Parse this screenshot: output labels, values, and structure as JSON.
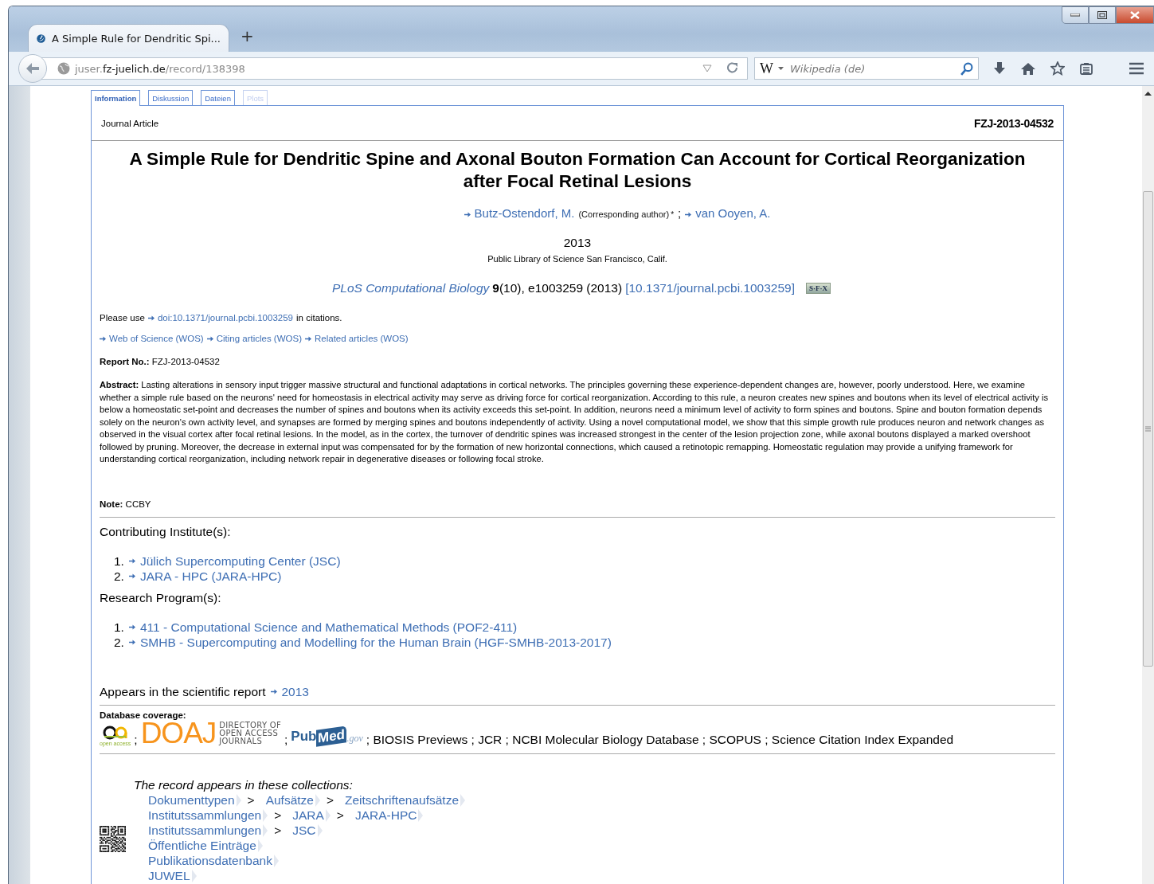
{
  "browser": {
    "tab": {
      "title": "A Simple Rule for Dendritic Spi...",
      "new_tab": "+"
    },
    "address": {
      "url": "juser.**fz-juelich.de**/record/138398"
    },
    "search": {
      "engine": "W",
      "placeholder": "Wikipedia (de)"
    }
  },
  "record_tabs": [
    {
      "label": "Information",
      "selected": true,
      "disabled": false
    },
    {
      "label": "Diskussion",
      "selected": false,
      "disabled": false
    },
    {
      "label": "Dateien",
      "selected": false,
      "disabled": false
    },
    {
      "label": "Plots",
      "selected": false,
      "disabled": true
    }
  ],
  "record": {
    "type": "Journal Article",
    "id": "FZJ-2013-04532",
    "title": "A Simple Rule for Dendritic Spine and Axonal Bouton Formation Can Account for Cortical Reorganization after Focal Retinal Lesions",
    "authors": [
      {
        "name": "Butz-Ostendorf, M.",
        "role": "(Corresponding author)",
        "mark": "*"
      },
      {
        "name": "van Ooyen, A."
      }
    ],
    "author_separator": ";",
    "year": "2013",
    "publisher": "Public Library of Science San Francisco, Calif.",
    "journal": "PLoS Computational Biology",
    "citation": "**9**(10), e1003259 (2013)",
    "doi_link": "[10.1371/journal.pcbi.1003259]",
    "sfx": "S·F·X",
    "please_use": {
      "before": "Please use",
      "link": "doi:10.1371/journal.pcbi.1003259",
      "after": "in citations."
    },
    "wos_links": [
      "Web of Science (WOS)",
      "Citing articles (WOS)",
      "Related articles (WOS)"
    ],
    "report": {
      "label": "Report No.:",
      "value": "FZJ-2013-04532"
    },
    "abstract": {
      "label": "Abstract:",
      "text": "Lasting alterations in sensory input trigger massive structural and functional adaptations in cortical networks. The principles governing these experience-dependent changes are, however, poorly understood. Here, we examine whether a simple rule based on the neurons' need for homeostasis in electrical activity may serve as driving force for cortical reorganization. According to this rule, a neuron creates new spines and boutons when its level of electrical activity is below a homeostatic set-point and decreases the number of spines and boutons when its activity exceeds this set-point. In addition, neurons need a minimum level of activity to form spines and boutons. Spine and bouton formation depends solely on the neuron's own activity level, and synapses are formed by merging spines and boutons independently of activity. Using a novel computational model, we show that this simple growth rule produces neuron and network changes as observed in the visual cortex after focal retinal lesions. In the model, as in the cortex, the turnover of dendritic spines was increased strongest in the center of the lesion projection zone, while axonal boutons displayed a marked overshoot followed by pruning. Moreover, the decrease in external input was compensated for by the formation of new horizontal connections, which caused a retinotopic remapping. Homeostatic regulation may provide a unifying framework for understanding cortical reorganization, including network repair in degenerative diseases or following focal stroke."
    },
    "note": {
      "label": "Note:",
      "value": "CCBY"
    },
    "institutes": {
      "heading": "Contributing Institute(s):",
      "items": [
        {
          "number": "1.",
          "label": "Jülich Supercomputing Center (JSC)"
        },
        {
          "number": "2.",
          "label": "JARA - HPC (JARA-HPC)"
        }
      ]
    },
    "programs": {
      "heading": "Research Program(s):",
      "items": [
        {
          "number": "1.",
          "label": "411 - Computational Science and Mathematical Methods (POF2-411)"
        },
        {
          "number": "2.",
          "label": "SMHB - Supercomputing and Modelling for the Human Brain (HGF-SMHB-2013-2017)"
        }
      ]
    },
    "report_year": {
      "label": "Appears in the scientific report",
      "link": "2013"
    },
    "coverage": {
      "label": "Database coverage:",
      "items": [
        {
          "kind": "oa",
          "caption": "open access"
        },
        {
          "kind": "sep",
          "text": ";"
        },
        {
          "kind": "doaj",
          "mark": "DOAJ",
          "lines": [
            "DIRECTORY OF",
            "OPEN ACCESS",
            "JOURNALS"
          ]
        },
        {
          "kind": "sep",
          "text": ";"
        },
        {
          "kind": "pubmed",
          "parts": [
            "Pub",
            "Med",
            ".gov"
          ]
        },
        {
          "kind": "text",
          "text": "; BIOSIS Previews ; JCR ; NCBI Molecular Biology Database ; SCOPUS ; Science Citation Index Expanded"
        }
      ]
    },
    "collections": {
      "heading": "The record appears in these collections:",
      "rows": [
        {
          "links": [
            "Dokumenttypen",
            "Aufsätze",
            "Zeitschriftenaufsätze"
          ],
          "separators": [
            ">",
            ">"
          ]
        },
        {
          "links": [
            "Institutssammlungen",
            "JARA",
            "JARA-HPC"
          ],
          "separators": [
            ">",
            ">"
          ]
        },
        {
          "links": [
            "Institutssammlungen",
            "JSC"
          ],
          "separators": [
            ">"
          ]
        },
        {
          "links": [
            "Öffentliche Einträge"
          ],
          "separators": []
        },
        {
          "links": [
            "Publikationsdatenbank"
          ],
          "separators": []
        },
        {
          "links": [
            "JUWEL"
          ],
          "separators": []
        }
      ]
    }
  }
}
